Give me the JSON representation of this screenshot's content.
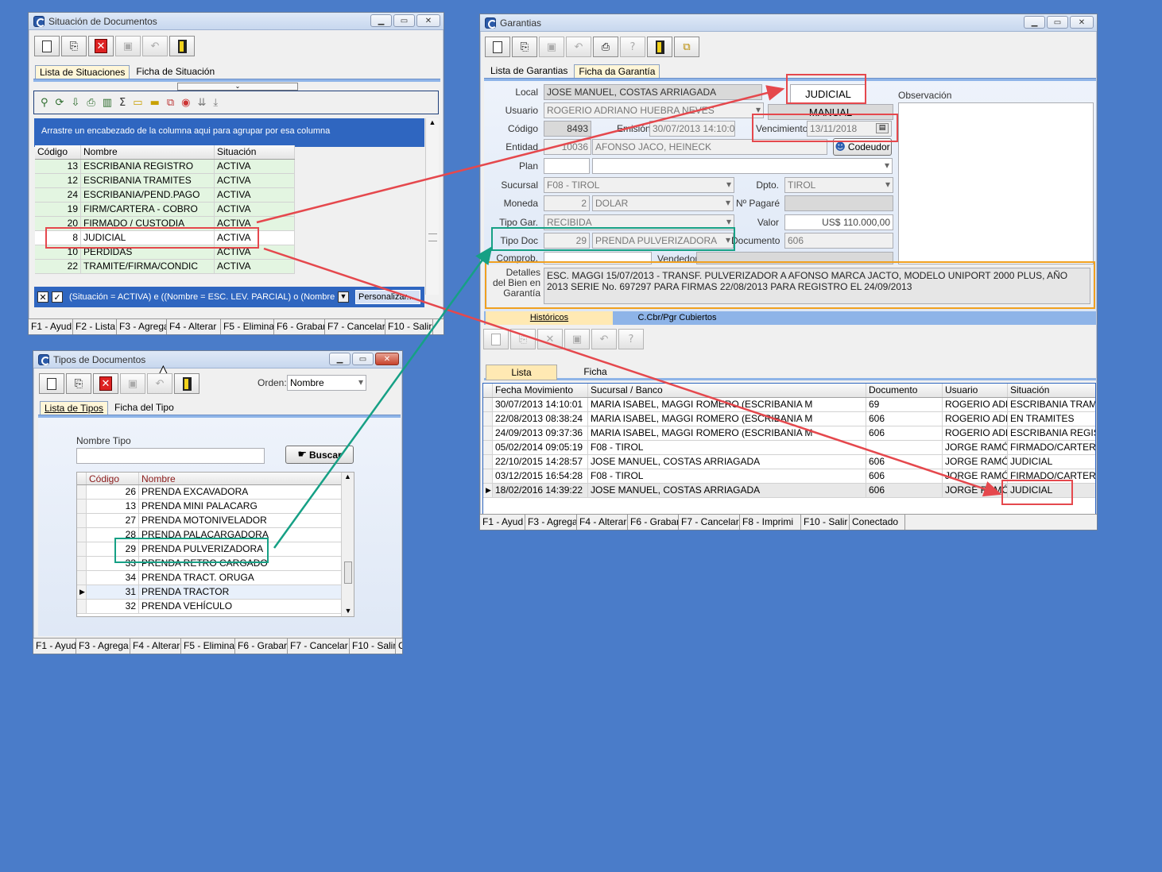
{
  "colors": {
    "desktop": "#4a7cc9",
    "red_highlight": "#e5484d",
    "green_highlight": "#16a085",
    "orange_highlight": "#f0a020",
    "tab_active": "#fff6d8"
  },
  "sit": {
    "title": "Situación de Documentos",
    "tabs": [
      "Lista de Situaciones",
      "Ficha de Situación"
    ],
    "group_hint": "Arrastre un encabezado de la columna aqui para agrupar por esa columna",
    "columns": [
      "Código",
      "Nombre",
      "Situación"
    ],
    "rows": [
      {
        "code": "13",
        "name": "ESCRIBANIA REGISTRO",
        "sit": "ACTIVA"
      },
      {
        "code": "12",
        "name": "ESCRIBANIA TRAMITES",
        "sit": "ACTIVA"
      },
      {
        "code": "24",
        "name": "ESCRIBANIA/PEND.PAGO",
        "sit": "ACTIVA"
      },
      {
        "code": "19",
        "name": "FIRM/CARTERA - COBRO",
        "sit": "ACTIVA"
      },
      {
        "code": "20",
        "name": "FIRMADO / CUSTODIA",
        "sit": "ACTIVA"
      },
      {
        "code": "8",
        "name": "JUDICIAL",
        "sit": "ACTIVA"
      },
      {
        "code": "10",
        "name": "PERDIDAS",
        "sit": "ACTIVA"
      },
      {
        "code": "22",
        "name": "TRAMITE/FIRMA/CONDIC",
        "sit": "ACTIVA"
      }
    ],
    "filter": "(Situación = ACTIVA) e ((Nombre = ESC. LEV. PARCIAL) o (Nombre -",
    "customize": "Personalizar...",
    "status": [
      "F1 - Ayud",
      "F2 - Lista",
      "F3 - Agrega",
      "F4 - Alterar",
      "F5 - Elimina",
      "F6 - Grabar",
      "F7 - Cancelar",
      "F10 - Salir"
    ]
  },
  "tipos": {
    "title": "Tipos de Documentos",
    "order_label": "Orden:",
    "order_value": "Nombre",
    "tabs": [
      "Lista de Tipos",
      "Ficha del Tipo"
    ],
    "name_label": "Nombre Tipo",
    "search": "Buscar",
    "columns": [
      "Código",
      "Nombre"
    ],
    "rows": [
      {
        "code": "26",
        "name": "PRENDA EXCAVADORA"
      },
      {
        "code": "13",
        "name": "PRENDA MINI PALACARG"
      },
      {
        "code": "27",
        "name": "PRENDA MOTONIVELADOR"
      },
      {
        "code": "28",
        "name": "PRENDA PALACARGADORA"
      },
      {
        "code": "29",
        "name": "PRENDA PULVERIZADORA"
      },
      {
        "code": "33",
        "name": "PRENDA RETRO CARGADO"
      },
      {
        "code": "34",
        "name": "PRENDA TRACT. ORUGA"
      },
      {
        "code": "31",
        "name": "PRENDA TRACTOR"
      },
      {
        "code": "32",
        "name": "PRENDA VEHÍCULO"
      }
    ],
    "status": [
      "F1 - Ayud",
      "F3 - Agrega",
      "F4 - Alterar",
      "F5 - Elimina",
      "F6 - Grabar",
      "F7 - Cancelar",
      "F10 - Salir",
      "Co"
    ]
  },
  "gar": {
    "title": "Garantias",
    "tabs": [
      "Lista de Garantias",
      "Ficha da Garantía"
    ],
    "labels": {
      "local": "Local",
      "usuario": "Usuario",
      "codigo": "Código",
      "emision": "Emisión",
      "vencimiento": "Vencimiento",
      "entidad": "Entidad",
      "plan": "Plan",
      "sucursal": "Sucursal",
      "dpto": "Dpto.",
      "moneda": "Moneda",
      "pagare": "Nº Pagaré",
      "tipogar": "Tipo Gar.",
      "valor": "Valor",
      "tipodoc": "Tipo Doc",
      "documento": "Documento",
      "comprob": "Comprob.",
      "vendedor": "Vendedor",
      "detalles": "Detalles del Bien en Garantía",
      "observacion": "Observación",
      "codeudor": "Codeudor"
    },
    "values": {
      "local": "JOSE MANUEL, COSTAS ARRIAGADA",
      "judicial": "JUDICIAL",
      "manual": "MANUAL",
      "usuario": "ROGERIO ADRIANO HUEBRA NEVES",
      "codigo": "8493",
      "emision": "30/07/2013 14:10:01",
      "vencimiento": "13/11/2018",
      "entidad_code": "10036",
      "entidad": "AFONSO JACO, HEINECK",
      "sucursal": "F08 - TIROL",
      "dpto": "TIROL",
      "moneda_code": "2",
      "moneda": "DOLAR",
      "tipogar": "RECIBIDA",
      "valor": "US$ 110.000,00",
      "tipodoc_code": "29",
      "tipodoc": "PRENDA PULVERIZADORA",
      "documento": "606",
      "detalles": "ESC. MAGGI 15/07/2013 - TRANSF. PULVERIZADOR A AFONSO MARCA JACTO, MODELO UNIPORT 2000 PLUS, AÑO 2013 SERIE No. 697297 PARA FIRMAS 22/08/2013 PARA REGISTRO EL 24/09/2013"
    },
    "subtabs": [
      "Históricos",
      "C.Cbr/Pgr Cubiertos"
    ],
    "listtabs": [
      "Lista",
      "Ficha"
    ],
    "columns": [
      "Fecha Movimiento",
      "Sucursal / Banco",
      "Documento",
      "Usuario",
      "Situación"
    ],
    "rows": [
      {
        "fecha": "30/07/2013 14:10:01",
        "suc": "MARIA ISABEL, MAGGI ROMERO (ESCRIBANIA M",
        "doc": "69",
        "usr": "ROGERIO ADR",
        "sit": "ESCRIBANIA TRAMIT"
      },
      {
        "fecha": "22/08/2013 08:38:24",
        "suc": "MARIA ISABEL, MAGGI ROMERO (ESCRIBANIA M",
        "doc": "606",
        "usr": "ROGERIO ADR",
        "sit": "EN TRAMITES"
      },
      {
        "fecha": "24/09/2013 09:37:36",
        "suc": "MARIA ISABEL, MAGGI ROMERO (ESCRIBANIA M",
        "doc": "606",
        "usr": "ROGERIO ADR",
        "sit": "ESCRIBANIA REGIST"
      },
      {
        "fecha": "05/02/2014 09:05:19",
        "suc": "F08 - TIROL",
        "doc": "",
        "usr": "JORGE RAMÓN",
        "sit": "FIRMADO/CARTERA"
      },
      {
        "fecha": "22/10/2015 14:28:57",
        "suc": "JOSE MANUEL, COSTAS ARRIAGADA",
        "doc": "606",
        "usr": "JORGE RAMÓN",
        "sit": "JUDICIAL"
      },
      {
        "fecha": "03/12/2015 16:54:28",
        "suc": "F08 - TIROL",
        "doc": "606",
        "usr": "JORGE RAMÓN",
        "sit": "FIRMADO/CARTERA"
      },
      {
        "fecha": "18/02/2016 14:39:22",
        "suc": "JOSE MANUEL, COSTAS ARRIAGADA",
        "doc": "606",
        "usr": "JORGE RAMÓN",
        "sit": "JUDICIAL"
      }
    ],
    "status": [
      "F1 - Ayud",
      "F3 - Agrega",
      "F4 - Alterar",
      "F6 - Grabar",
      "F7 - Cancelar",
      "F8 - Imprimi",
      "F10 - Salir",
      "Conectado"
    ]
  }
}
